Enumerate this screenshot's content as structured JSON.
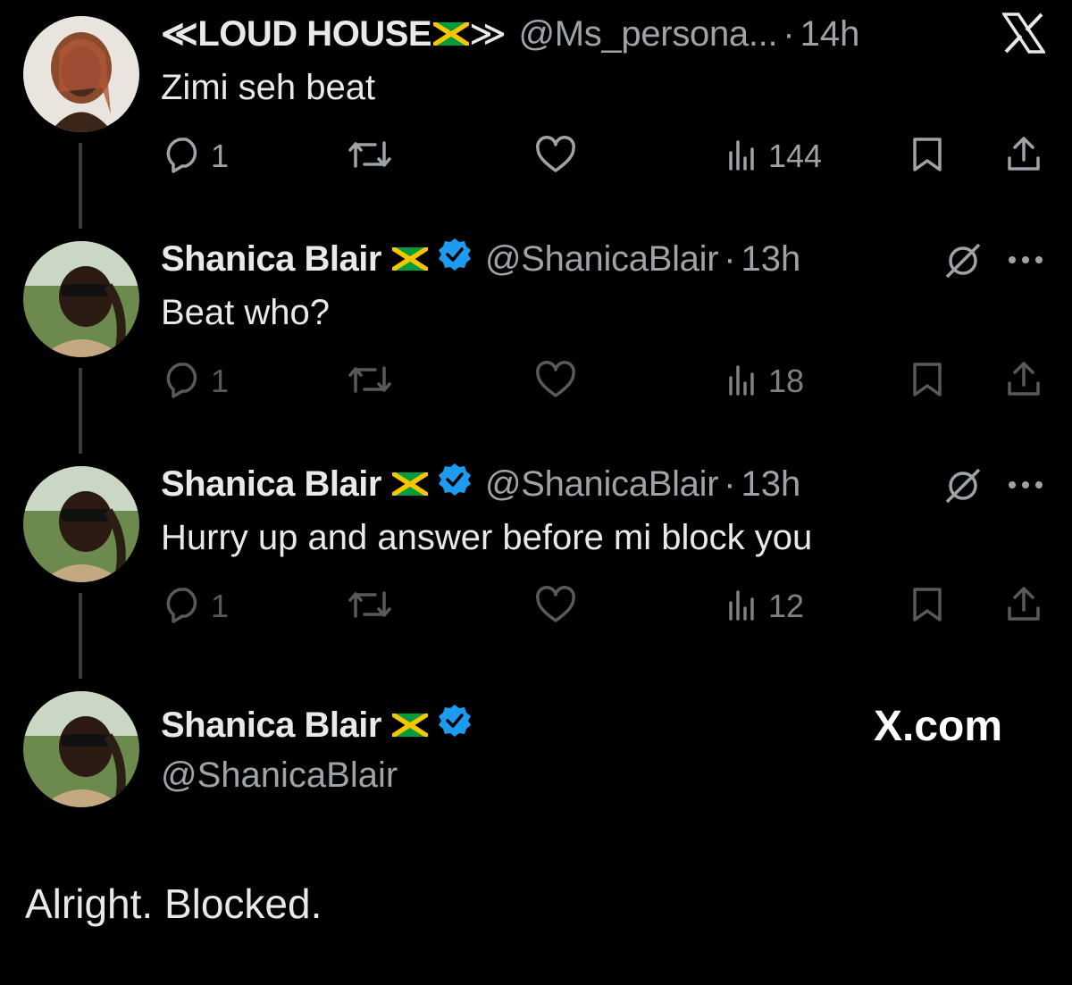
{
  "colors": {
    "background": "#000000",
    "text": "#e7e9ea",
    "muted": "#9ea3a8",
    "verified": "#1d9bf0",
    "thread_line": "#3a3d40"
  },
  "tweets": [
    {
      "name": "≪LOUD HOUSE",
      "name_suffix": "≫",
      "handle": "@Ms_persona...",
      "dot": "·",
      "time": "14h",
      "text": "Zimi seh beat",
      "replies": "1",
      "views": "144",
      "verified": false,
      "corner_icon": "x-logo-icon"
    },
    {
      "name": "Shanica Blair",
      "handle": "@ShanicaBlair",
      "dot": "·",
      "time": "13h",
      "text": "Beat who?",
      "replies": "1",
      "views": "18",
      "verified": true,
      "corner_icon": "grok-icon"
    },
    {
      "name": "Shanica Blair",
      "handle": "@ShanicaBlair",
      "dot": "·",
      "time": "13h",
      "text": "Hurry up and answer before mi block you",
      "replies": "1",
      "views": "12",
      "verified": true,
      "corner_icon": "grok-icon"
    }
  ],
  "profile_card": {
    "name": "Shanica Blair",
    "handle": "@ShanicaBlair",
    "site": "X.com"
  },
  "caption": "Alright. Blocked.",
  "icons": [
    "reply-icon",
    "retweet-icon",
    "like-icon",
    "views-icon",
    "bookmark-icon",
    "share-icon",
    "more-icon",
    "jamaica-flag-icon",
    "verified-badge-icon"
  ]
}
